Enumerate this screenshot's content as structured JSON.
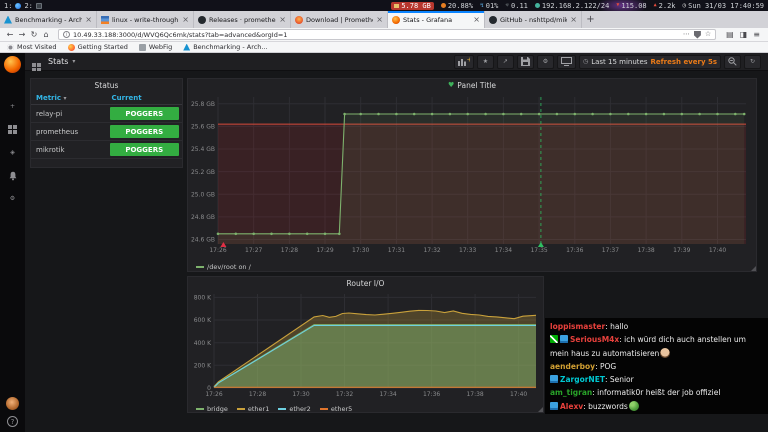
{
  "statusbar": {
    "workspaces": [
      {
        "label": "1:",
        "icon": "firefox-ws-icon"
      },
      {
        "label": "2:",
        "icon": "terminal-ws-icon"
      }
    ],
    "segments": [
      {
        "name": "memory",
        "icon": "ram-icon",
        "value": "5.78 GB",
        "pill": true
      },
      {
        "name": "cpu",
        "icon": "cpu-load-icon",
        "value": "20.88%"
      },
      {
        "name": "battery",
        "icon": "bolt-icon",
        "value": "01%"
      },
      {
        "name": "load",
        "icon": "fan-icon",
        "value": "0.11"
      },
      {
        "name": "network",
        "icon": "globe-icon",
        "value": "192.168.2.122/24"
      },
      {
        "name": "net-down",
        "icon": "down-icon",
        "value": "115.08"
      },
      {
        "name": "net-up",
        "icon": "up-icon",
        "value": "2.2k"
      },
      {
        "name": "clock",
        "icon": "clock-icon",
        "value": "Sun 31/03 17:40:59"
      }
    ]
  },
  "browser": {
    "tabs": [
      {
        "title": "Benchmarking - ArchWi...",
        "icon": "arch-favicon",
        "active": false
      },
      {
        "title": "linux - write-through RA...",
        "icon": "stackexchange-favicon",
        "active": false
      },
      {
        "title": "Releases · prometheus/p...",
        "icon": "github-favicon",
        "active": false
      },
      {
        "title": "Download | Prometheus",
        "icon": "prometheus-favicon",
        "active": false
      },
      {
        "title": "Stats - Grafana",
        "icon": "grafana-favicon",
        "active": true
      },
      {
        "title": "GitHub - nshttpd/mikrot...",
        "icon": "github-favicon",
        "active": false
      }
    ],
    "new_tab_label": "+",
    "nav_icons": [
      "back-icon",
      "forward-icon",
      "reload-icon",
      "home-icon"
    ],
    "url": "10.49.33.188:3000/d/WVQ6Qc6mk/stats?tab=advanced&orgId=1",
    "url_field_icons": [
      "page-actions-icon",
      "pocket-icon",
      "bookmark-star-icon"
    ],
    "toolbar_right_icons": [
      "library-icon",
      "sidebar-icon",
      "menu-icon"
    ],
    "bookmarks": [
      {
        "label": "Most Visited",
        "icon": "gear-favicon"
      },
      {
        "label": "Getting Started",
        "icon": "firefox-favicon"
      },
      {
        "label": "WebFig",
        "icon": "webfig-favicon"
      },
      {
        "label": "Benchmarking - Arch...",
        "icon": "arch-favicon"
      }
    ]
  },
  "grafana": {
    "sidebar": {
      "icons": [
        "add-icon",
        "dashboards-icon",
        "explore-icon",
        "alerting-icon",
        "settings-icon"
      ],
      "bottom": [
        "avatar",
        "help-icon"
      ]
    },
    "navbar": {
      "left_icon": "dashboard-grid-icon",
      "title": "Stats",
      "right_icons": [
        "add-panel-icon",
        "star-icon",
        "share-icon",
        "save-icon",
        "settings-icon",
        "tv-icon"
      ],
      "time_icon": "clock-icon",
      "time_range": "Last 15 minutes",
      "refresh": "Refresh every 5s",
      "trailing_icons": [
        "zoom-out-icon",
        "refresh-icon"
      ]
    },
    "status_panel": {
      "title": "Status",
      "columns": [
        {
          "label": "Metric",
          "sorted": true
        },
        {
          "label": "Current",
          "sorted": false
        }
      ],
      "rows": [
        {
          "metric": "relay-pi",
          "current": "POGGERS"
        },
        {
          "metric": "prometheus",
          "current": "POGGERS"
        },
        {
          "metric": "mikrotik",
          "current": "POGGERS"
        }
      ],
      "ok_color": "#33ad41"
    }
  },
  "chart_data": [
    {
      "type": "line",
      "title": "Panel Title",
      "alert_state": "ok",
      "ylim": [
        24.56,
        25.86
      ],
      "yticks": [
        "25.8 GB",
        "25.6 GB",
        "25.4 GB",
        "25.2 GB",
        "25.0 GB",
        "24.8 GB",
        "24.6 GB"
      ],
      "ytick_vals": [
        25.8,
        25.6,
        25.4,
        25.2,
        25.0,
        24.8,
        24.6
      ],
      "xlim": [
        0,
        14.8
      ],
      "xticks": [
        "17:26",
        "17:27",
        "17:28",
        "17:29",
        "17:30",
        "17:31",
        "17:32",
        "17:33",
        "17:34",
        "17:35",
        "17:36",
        "17:37",
        "17:38",
        "17:39",
        "17:40"
      ],
      "xtick_vals": [
        0,
        1,
        2,
        3,
        4,
        5,
        6,
        7,
        8,
        9,
        10,
        11,
        12,
        13,
        14
      ],
      "threshold_region": {
        "value": 25.62,
        "fill": "rgba(229,32,38,0.12)",
        "line": "#d44a3a"
      },
      "annotation": {
        "x": 9.05,
        "color": "#2fbf62"
      },
      "alert_marker": {
        "x": 0.15,
        "color": "#e02f44"
      },
      "series": [
        {
          "name": "/dev/root on /",
          "color": "#7eb26d",
          "width": 1.1,
          "fill_opacity": 0.09,
          "markers": true,
          "x": [
            0,
            0.5,
            1,
            1.5,
            2,
            2.5,
            3,
            3.4,
            3.55,
            4,
            4.5,
            5,
            5.5,
            6,
            6.5,
            7,
            7.5,
            8,
            8.5,
            9,
            9.5,
            10,
            10.5,
            11,
            11.5,
            12,
            12.5,
            13,
            13.5,
            14,
            14.5,
            14.75
          ],
          "y": [
            24.65,
            24.65,
            24.65,
            24.65,
            24.65,
            24.65,
            24.65,
            24.65,
            25.71,
            25.71,
            25.71,
            25.71,
            25.71,
            25.71,
            25.71,
            25.71,
            25.71,
            25.71,
            25.71,
            25.71,
            25.71,
            25.71,
            25.71,
            25.71,
            25.71,
            25.71,
            25.71,
            25.71,
            25.71,
            25.71,
            25.71,
            25.71
          ]
        }
      ],
      "legend": [
        {
          "name": "/dev/root on /",
          "color": "#7eb26d"
        }
      ]
    },
    {
      "type": "area",
      "title": "Router I/O",
      "ylim": [
        0,
        830
      ],
      "yticks": [
        "800 K",
        "600 K",
        "400 K",
        "200 K",
        "0"
      ],
      "ytick_vals": [
        800,
        600,
        400,
        200,
        0
      ],
      "xlim": [
        0,
        14.8
      ],
      "xticks": [
        "17:26",
        "17:28",
        "17:30",
        "17:32",
        "17:34",
        "17:36",
        "17:38",
        "17:40"
      ],
      "xtick_vals": [
        0,
        2,
        4,
        6,
        8,
        10,
        12,
        14
      ],
      "series": [
        {
          "name": "ether1",
          "color": "#c9a13b",
          "width": 1.1,
          "fill_opacity": 0.28,
          "x": [
            0,
            0.2,
            4.6,
            5.0,
            5.3,
            5.6,
            5.9,
            6.2,
            6.6,
            7.0,
            7.4,
            7.8,
            8.2,
            8.6,
            9.0,
            9.4,
            9.8,
            10.2,
            10.6,
            11.0,
            11.4,
            11.8,
            12.2,
            12.6,
            13.0,
            13.4,
            13.8,
            14.2,
            14.8
          ],
          "y": [
            12,
            55,
            628,
            640,
            624,
            632,
            658,
            662,
            655,
            648,
            645,
            652,
            660,
            668,
            678,
            685,
            684,
            680,
            666,
            680,
            660,
            650,
            645,
            632,
            628,
            620,
            612,
            634,
            642
          ]
        },
        {
          "name": "bridge",
          "color": "#7eb26d",
          "width": 1,
          "fill_opacity": 0.5,
          "x": [
            0,
            0.2,
            4.6,
            14.8
          ],
          "y": [
            8,
            48,
            560,
            560
          ]
        },
        {
          "name": "ether2",
          "color": "#6ed0e0",
          "width": 1,
          "fill_opacity": 0,
          "x": [
            0,
            0.2,
            4.6,
            14.8
          ],
          "y": [
            5,
            44,
            552,
            552
          ]
        },
        {
          "name": "ether5",
          "color": "#e0752d",
          "width": 1,
          "fill_opacity": 0,
          "x": [
            0,
            14.8
          ],
          "y": [
            6,
            6
          ]
        }
      ],
      "legend": [
        {
          "name": "bridge",
          "color": "#7eb26d"
        },
        {
          "name": "ether1",
          "color": "#c9a13b"
        },
        {
          "name": "ether2",
          "color": "#6ed0e0"
        },
        {
          "name": "ether5",
          "color": "#e0752d"
        }
      ]
    }
  ],
  "chat": {
    "messages": [
      {
        "badges": [],
        "user": "loppismaster",
        "color": "#e8413c",
        "text": "hallo"
      },
      {
        "badges": [
          "moderator",
          "subscriber"
        ],
        "user": "SeriousM4x",
        "color": "#e8413c",
        "text": "ich würd dich auch anstellen um mein haus zu automatisieren",
        "emote": "bearded-man"
      },
      {
        "badges": [],
        "user": "aenderboy",
        "color": "#d2a033",
        "text": "POG"
      },
      {
        "badges": [
          "subscriber"
        ],
        "user": "ZargorNET",
        "color": "#00c8d2",
        "text": "Senior"
      },
      {
        "badges": [],
        "user": "am_tigran",
        "color": "#29a329",
        "text": "informatik0r heißt der job offiziel"
      },
      {
        "badges": [
          "subscriber"
        ],
        "user": "Alexv",
        "color": "#e8413c",
        "text": "buzzwords",
        "emote": "pepe"
      }
    ]
  }
}
